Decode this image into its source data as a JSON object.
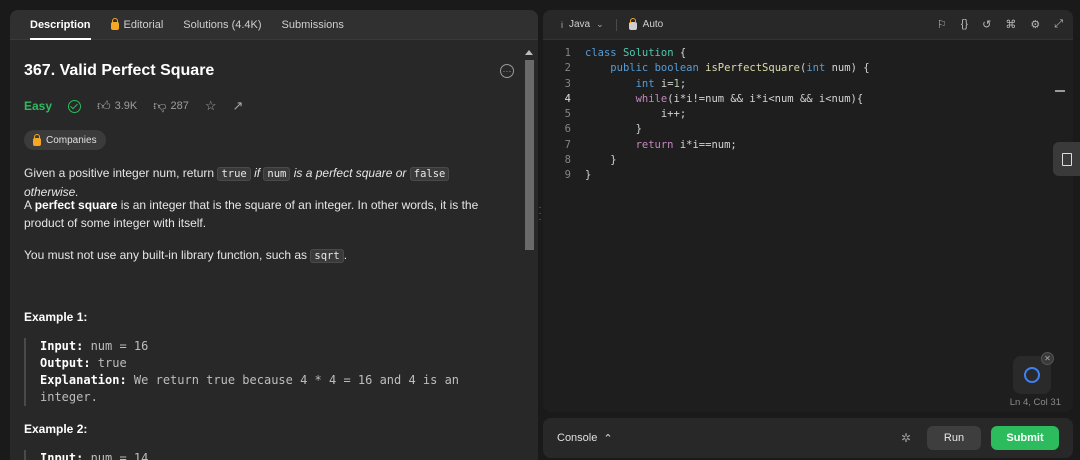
{
  "tabs": [
    {
      "label": "Description"
    },
    {
      "label": "Editorial"
    },
    {
      "label": "Solutions (4.4K)"
    },
    {
      "label": "Submissions"
    }
  ],
  "problem": {
    "title": "367. Valid Perfect Square",
    "difficulty": "Easy",
    "likes": "3.9K",
    "dislikes": "287",
    "companies": "Companies",
    "desc1": {
      "pre": "Given a positive integer num, return ",
      "c1": "true",
      "mid1": " if ",
      "c2": "num",
      "mid2": " is a perfect square or ",
      "c3": "false",
      "post": " otherwise."
    },
    "desc2": {
      "pre": "A ",
      "bold": "perfect square",
      "post": " is an integer that is the square of an integer. In other words, it is the product of some integer with itself."
    },
    "desc3": {
      "pre": "You must not use any built-in library function, such as ",
      "code": "sqrt",
      "post": "."
    },
    "example1": {
      "title": "Example 1:",
      "input_label": "Input:",
      "input": " num = 16",
      "output_label": "Output:",
      "output": " true",
      "expl_label": "Explanation:",
      "expl": " We return true because 4 * 4 = 16 and 4 is an integer."
    },
    "example2": {
      "title": "Example 2:",
      "input_label": "Input:",
      "input": " num = 14"
    }
  },
  "editor": {
    "language": "Java",
    "mode": "Auto",
    "status": "Ln 4, Col 31",
    "line_numbers": [
      "1",
      "2",
      "3",
      "4",
      "5",
      "6",
      "7",
      "8",
      "9"
    ]
  },
  "console": {
    "label": "Console",
    "run_label": "Run",
    "submit_label": "Submit"
  },
  "colors": {
    "accent_green": "#2cbb5d",
    "bg": "#1a1a1a",
    "panel": "#282828"
  }
}
